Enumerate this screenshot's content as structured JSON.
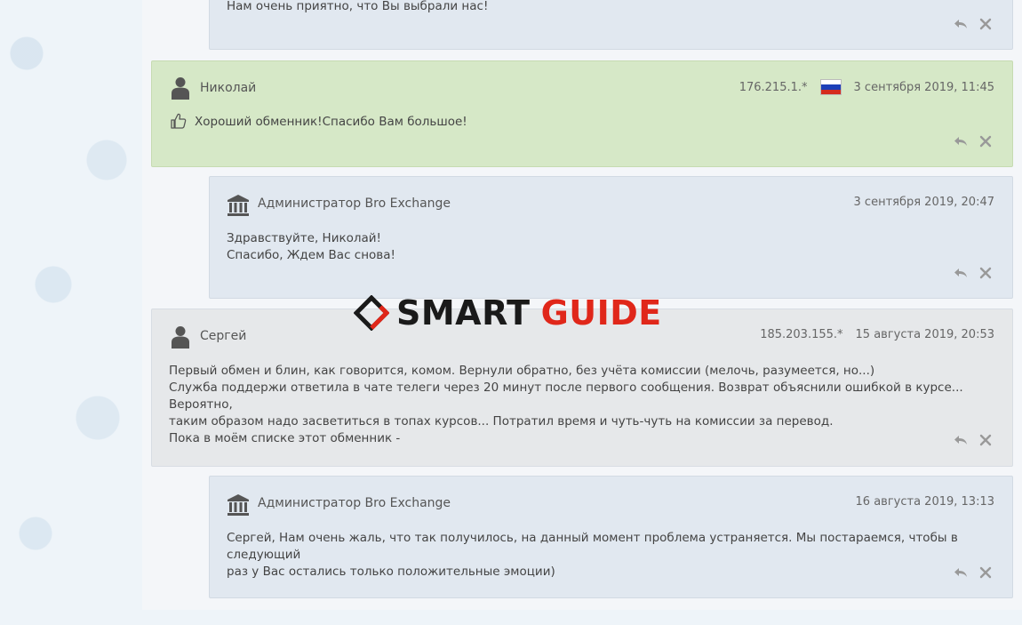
{
  "top_reply": {
    "text": "Нам очень приятно, что Вы выбрали нас!"
  },
  "reviews": [
    {
      "author": "Николай",
      "ip": "176.215.1.*",
      "date": "3 сентября 2019, 11:45",
      "text": "Хороший обменник!Спасибо Вам большое!",
      "reply": {
        "author": "Администратор Bro Exchange",
        "date": "3 сентября 2019, 20:47",
        "lines": [
          "Здравствуйте, Николай!",
          "Спасибо, Ждем Вас снова!"
        ]
      }
    },
    {
      "author": "Сергей",
      "ip": "185.203.155.*",
      "date": "15 августа 2019, 20:53",
      "lines": [
        "Первый обмен и блин, как говорится, комом. Вернули обратно, без учёта комиссии (мелочь, разумеется, но...)",
        "Служба поддержи ответила в чате телеги через 20 минут после первого сообщения. Возврат объяснили ошибкой в курсе... Вероятно,",
        "таким образом надо засветиться в топах курсов... Потратил время и чуть-чуть на комиссии за перевод.",
        "Пока в моём списке этот обменник -"
      ],
      "reply": {
        "author": "Администратор Bro Exchange",
        "date": "16 августа 2019, 13:13",
        "lines": [
          "Сергей, Нам очень жаль, что так получилось, на данный момент проблема устраняется. Мы постараемся, чтобы в следующий",
          "раз у Вас остались только положительные эмоции)"
        ]
      }
    }
  ],
  "watermark": {
    "left": "SMART",
    "right": "GUIDE"
  },
  "icons": {
    "reply": "reply-arrow-icon",
    "close": "close-icon",
    "user": "user-avatar-icon",
    "admin": "bank-icon",
    "like": "thumbs-up-icon",
    "flag": "russia-flag-icon"
  },
  "colors": {
    "green_card": "#d6e8c7",
    "admin_card": "#e1e8f0",
    "user_card": "#e6e8ea",
    "accent": "#e0271a"
  }
}
